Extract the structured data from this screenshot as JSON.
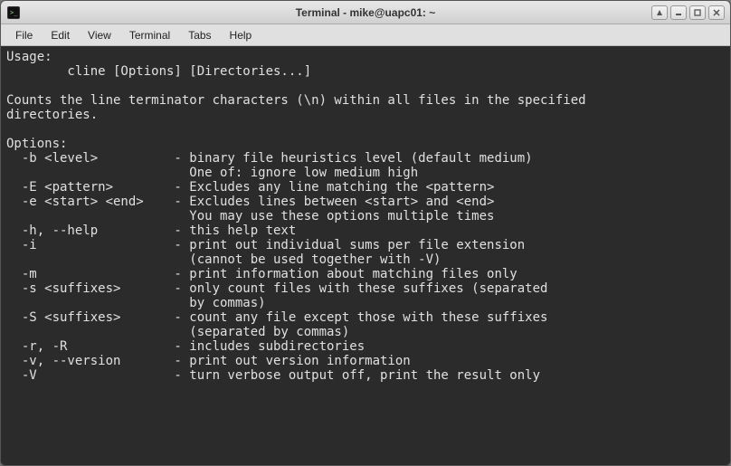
{
  "window": {
    "title": "Terminal - mike@uapc01: ~"
  },
  "menubar": {
    "items": [
      "File",
      "Edit",
      "View",
      "Terminal",
      "Tabs",
      "Help"
    ]
  },
  "terminal": {
    "lines": [
      "Usage:",
      "        cline [Options] [Directories...]",
      "",
      "Counts the line terminator characters (\\n) within all files in the specified",
      "directories.",
      "",
      "Options:",
      "  -b <level>          - binary file heuristics level (default medium)",
      "                        One of: ignore low medium high",
      "  -E <pattern>        - Excludes any line matching the <pattern>",
      "  -e <start> <end>    - Excludes lines between <start> and <end>",
      "                        You may use these options multiple times",
      "  -h, --help          - this help text",
      "  -i                  - print out individual sums per file extension",
      "                        (cannot be used together with -V)",
      "  -m                  - print information about matching files only",
      "  -s <suffixes>       - only count files with these suffixes (separated",
      "                        by commas)",
      "  -S <suffixes>       - count any file except those with these suffixes",
      "                        (separated by commas)",
      "  -r, -R              - includes subdirectories",
      "  -v, --version       - print out version information",
      "  -V                  - turn verbose output off, print the result only"
    ]
  }
}
